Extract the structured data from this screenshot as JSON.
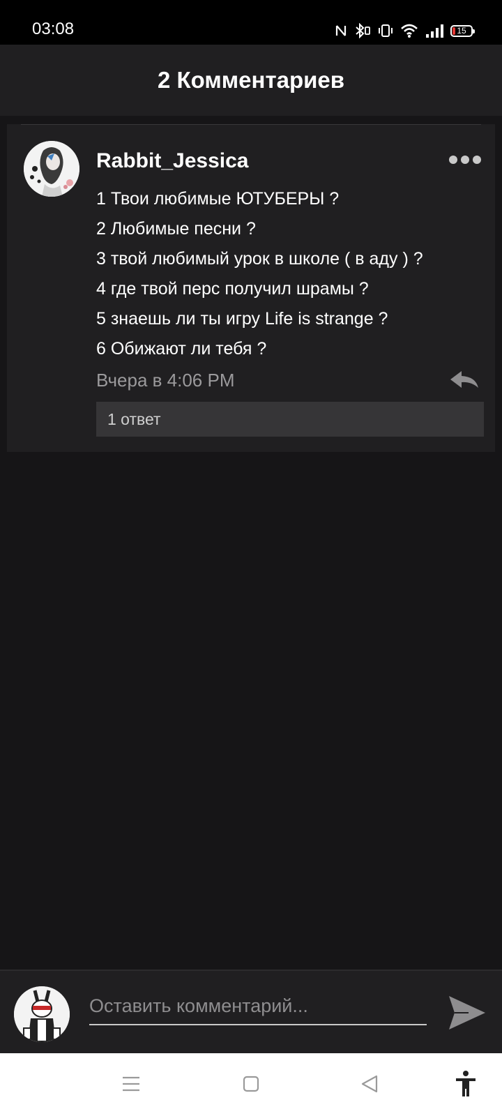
{
  "status_bar": {
    "time": "03:08",
    "battery_level": "15",
    "icons": [
      "nfc-icon",
      "bluetooth-icon",
      "vibrate-icon",
      "wifi-icon",
      "signal-icon",
      "battery-icon"
    ]
  },
  "header": {
    "title": "2 Комментариев"
  },
  "comment": {
    "username": "Rabbit_Jessica",
    "lines": [
      "1 Твои любимые ЮТУБЕРЫ ?",
      "2 Любимые песни ?",
      "3 твой любимый урок в школе ( в аду ) ?",
      "4 где твой перс получил шрамы ?",
      "5 знаешь ли ты игру Life is strange ?",
      "6 Обижают ли тебя ?"
    ],
    "timestamp": "Вчера в 4:06 PM",
    "replies_label": "1 ответ"
  },
  "input_bar": {
    "placeholder": "Оставить комментарий..."
  },
  "colors": {
    "background": "#161517",
    "surface": "#201f21",
    "muted_text": "#9b9a9c",
    "reply_box": "#363537"
  }
}
